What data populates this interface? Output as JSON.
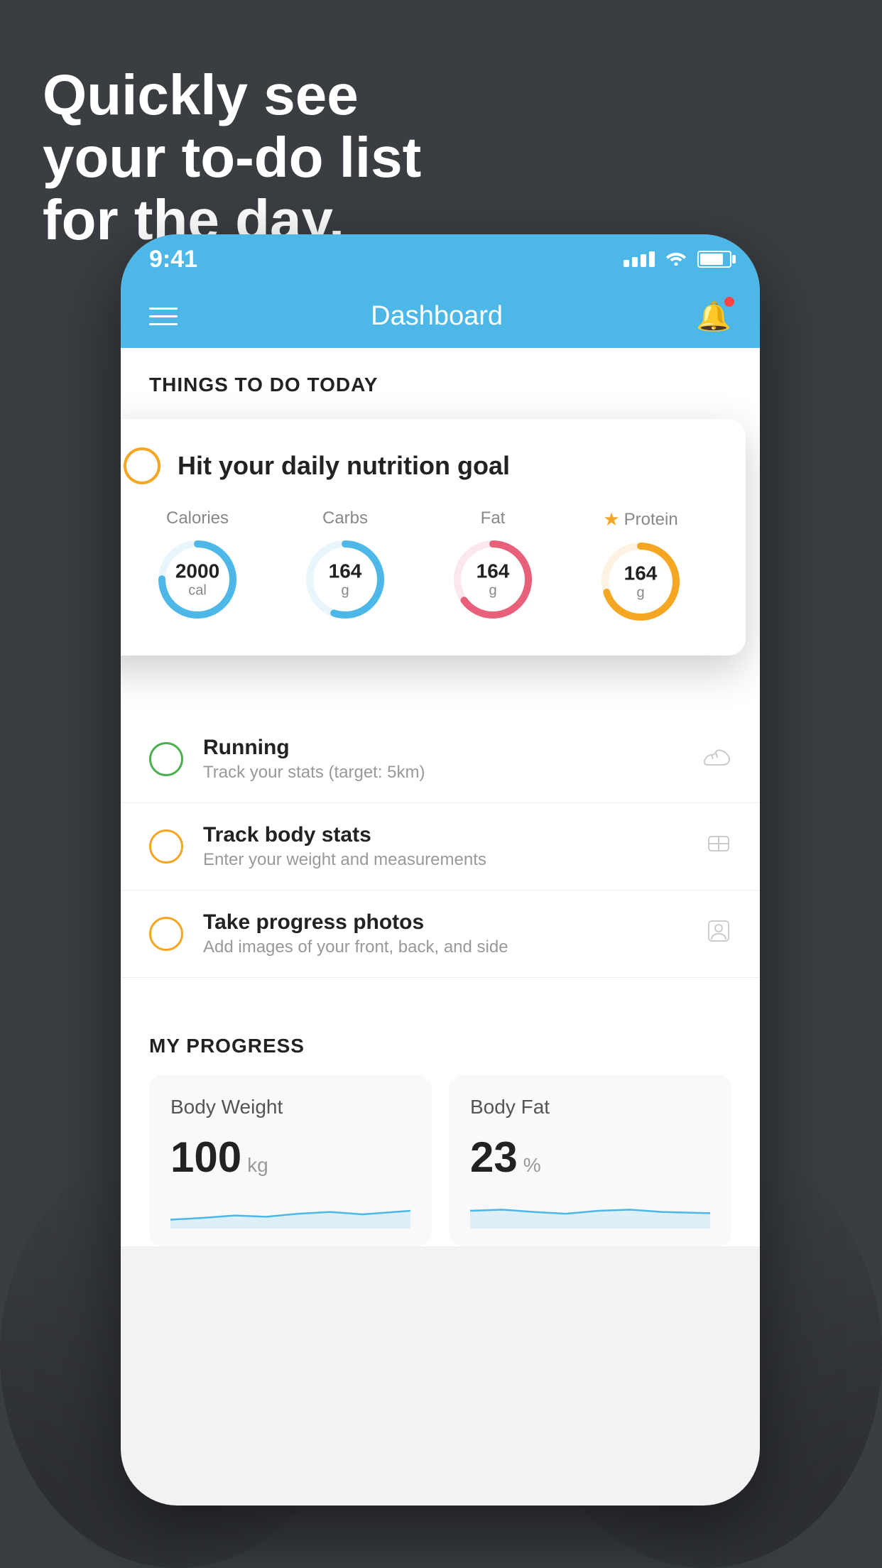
{
  "headline": {
    "line1": "Quickly see",
    "line2": "your to-do list",
    "line3": "for the day."
  },
  "phone": {
    "status_bar": {
      "time": "9:41"
    },
    "header": {
      "title": "Dashboard"
    },
    "things_section": {
      "heading": "THINGS TO DO TODAY"
    },
    "floating_card": {
      "title": "Hit your daily nutrition goal",
      "nutrition": [
        {
          "label": "Calories",
          "value": "2000",
          "unit": "cal",
          "color": "#4db8e8",
          "track": 75,
          "starred": false
        },
        {
          "label": "Carbs",
          "value": "164",
          "unit": "g",
          "color": "#4db8e8",
          "track": 55,
          "starred": false
        },
        {
          "label": "Fat",
          "value": "164",
          "unit": "g",
          "color": "#e8607a",
          "track": 65,
          "starred": false
        },
        {
          "label": "Protein",
          "value": "164",
          "unit": "g",
          "color": "#f5a623",
          "track": 70,
          "starred": true
        }
      ]
    },
    "todo_items": [
      {
        "title": "Running",
        "subtitle": "Track your stats (target: 5km)",
        "circle_color": "green",
        "icon": "👟"
      },
      {
        "title": "Track body stats",
        "subtitle": "Enter your weight and measurements",
        "circle_color": "yellow",
        "icon": "⚖"
      },
      {
        "title": "Take progress photos",
        "subtitle": "Add images of your front, back, and side",
        "circle_color": "yellow",
        "icon": "👤"
      }
    ],
    "progress_section": {
      "heading": "MY PROGRESS",
      "cards": [
        {
          "title": "Body Weight",
          "value": "100",
          "unit": "kg"
        },
        {
          "title": "Body Fat",
          "value": "23",
          "unit": "%"
        }
      ]
    }
  }
}
